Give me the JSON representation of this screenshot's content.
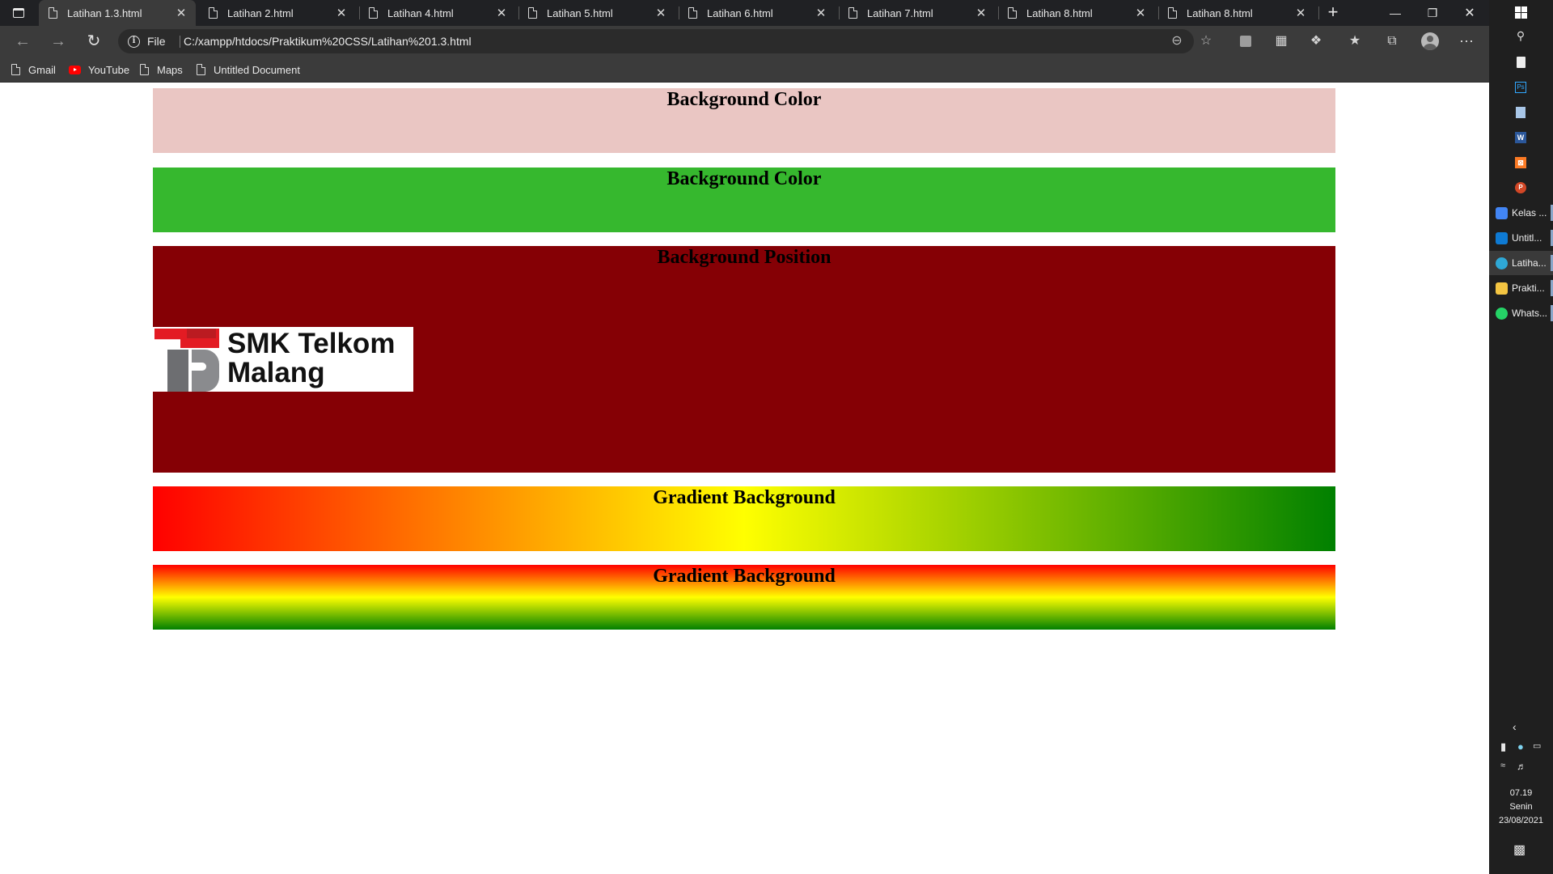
{
  "tabs": [
    {
      "title": "Latihan 1.3.html",
      "active": true
    },
    {
      "title": "Latihan 2.html",
      "active": false
    },
    {
      "title": "Latihan 4.html",
      "active": false
    },
    {
      "title": "Latihan 5.html",
      "active": false
    },
    {
      "title": "Latihan 6.html",
      "active": false
    },
    {
      "title": "Latihan 7.html",
      "active": false
    },
    {
      "title": "Latihan 8.html",
      "active": false
    },
    {
      "title": "Latihan 8.html",
      "active": false
    }
  ],
  "tab_close_glyph": "✕",
  "new_tab_glyph": "+",
  "window_controls": {
    "minimize": "—",
    "restore": "❐",
    "close": "✕"
  },
  "toolbar": {
    "scheme_label": "File",
    "url": "C:/xampp/htdocs/Praktikum%20CSS/Latihan%201.3.html"
  },
  "bookmarks": [
    {
      "label": "Gmail",
      "icon": "page-icon"
    },
    {
      "label": "YouTube",
      "icon": "youtube-icon"
    },
    {
      "label": "Maps",
      "icon": "page-icon"
    },
    {
      "label": "Untitled Document",
      "icon": "page-icon"
    }
  ],
  "page": {
    "boxes": [
      {
        "heading": "Background Color",
        "background": "#eac6c3"
      },
      {
        "heading": "Background Color",
        "background": "#36b82e"
      },
      {
        "heading": "Background Position",
        "background": "#850005"
      },
      {
        "heading": "Gradient Background",
        "background": "linear-gradient(to right, red, yellow, green)"
      },
      {
        "heading": "Gradient Background",
        "background": "linear-gradient(to bottom, red, yellow, green)"
      }
    ],
    "logo_text_line1": "SMK Telkom",
    "logo_text_line2": "Malang"
  },
  "taskbar": {
    "apps": [
      {
        "label": "Kelas ...",
        "icon_color": "#4285f4",
        "active": false
      },
      {
        "label": "Untitl...",
        "icon_color": "#0e7ad3",
        "active": false
      },
      {
        "label": "Latiha...",
        "icon_color": "#2fa8d6",
        "active": true
      },
      {
        "label": "Prakti...",
        "icon_color": "#f4c542",
        "active": false
      },
      {
        "label": "Whats...",
        "icon_color": "#25d366",
        "active": false
      }
    ],
    "clock": {
      "time": "07.19",
      "day": "Senin",
      "date": "23/08/2021"
    }
  }
}
